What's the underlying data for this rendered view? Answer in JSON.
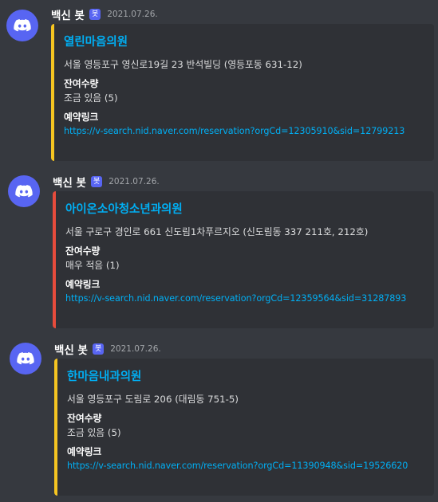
{
  "messages": [
    {
      "author": "백신 봇",
      "bot_tag": "봇",
      "timestamp": "2021.07.26.",
      "avatar_icon": "discord-logo-icon",
      "embed": {
        "accent_color": "#f6c521",
        "title": "열린마음의원",
        "description": "서울 영등포구 영신로19길 23 반석빌딩 (영등포동 631-12)",
        "fields": [
          {
            "name": "잔여수량",
            "value": "조금 있음 (5)"
          },
          {
            "name": "예약링크",
            "value": "https://v-search.nid.naver.com/reservation?orgCd=12305910&sid=12799213"
          }
        ]
      }
    },
    {
      "author": "백신 봇",
      "bot_tag": "봇",
      "timestamp": "2021.07.26.",
      "avatar_icon": "discord-logo-icon",
      "embed": {
        "accent_color": "#e74c3c",
        "title": "아이온소아청소년과의원",
        "description": "서울 구로구 경인로 661 신도림1차푸르지오 (신도림동 337 211호, 212호)",
        "fields": [
          {
            "name": "잔여수량",
            "value": "매우 적음 (1)"
          },
          {
            "name": "예약링크",
            "value": "https://v-search.nid.naver.com/reservation?orgCd=12359564&sid=31287893"
          }
        ]
      }
    },
    {
      "author": "백신 봇",
      "bot_tag": "봇",
      "timestamp": "2021.07.26.",
      "avatar_icon": "discord-logo-icon",
      "embed": {
        "accent_color": "#f6c521",
        "title": "한마음내과의원",
        "description": "서울 영등포구 도림로 206 (대림동 751-5)",
        "fields": [
          {
            "name": "잔여수량",
            "value": "조금 있음 (5)"
          },
          {
            "name": "예약링크",
            "value": "https://v-search.nid.naver.com/reservation?orgCd=11390948&sid=19526620"
          }
        ]
      }
    }
  ]
}
